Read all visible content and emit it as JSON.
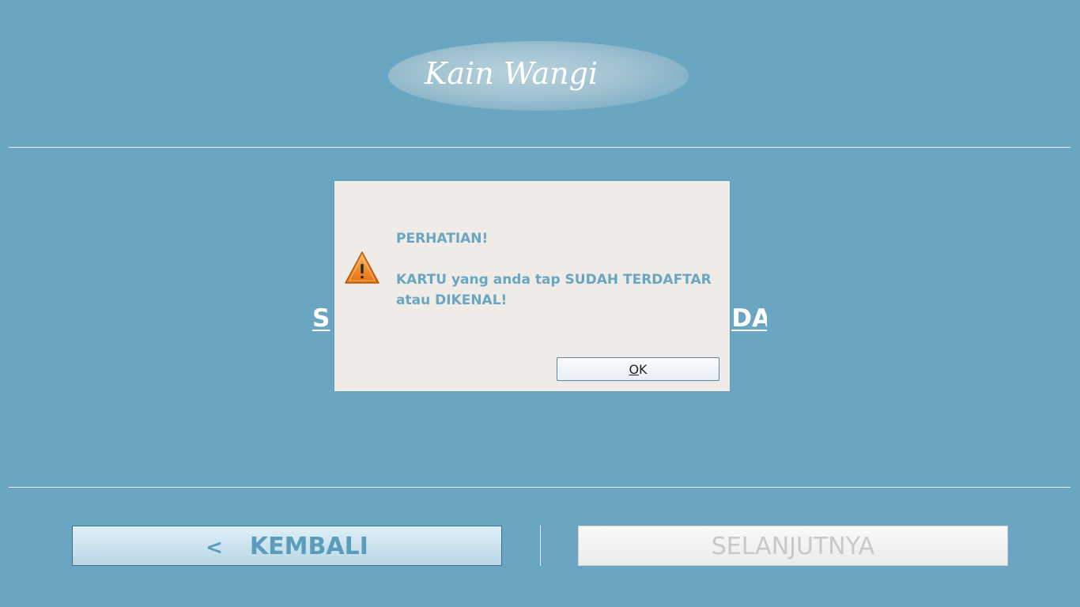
{
  "app": {
    "logo_text": "Kain Wangi"
  },
  "main": {
    "instruction_left": "S",
    "instruction_right": "DA!"
  },
  "dialog": {
    "title": "PERHATIAN!",
    "message": "KARTU yang anda tap SUDAH TERDAFTAR atau DIKENAL!",
    "ok_mnemonic": "O",
    "ok_rest": "K",
    "icon": "warning-icon"
  },
  "footer": {
    "back_arrow": "<",
    "back_label": "KEMBALI",
    "next_label": "SELANJUTNYA"
  },
  "colors": {
    "background": "#6aa6c1",
    "dialog_bg": "#efebe7",
    "accent_text": "#6aa6c1"
  }
}
